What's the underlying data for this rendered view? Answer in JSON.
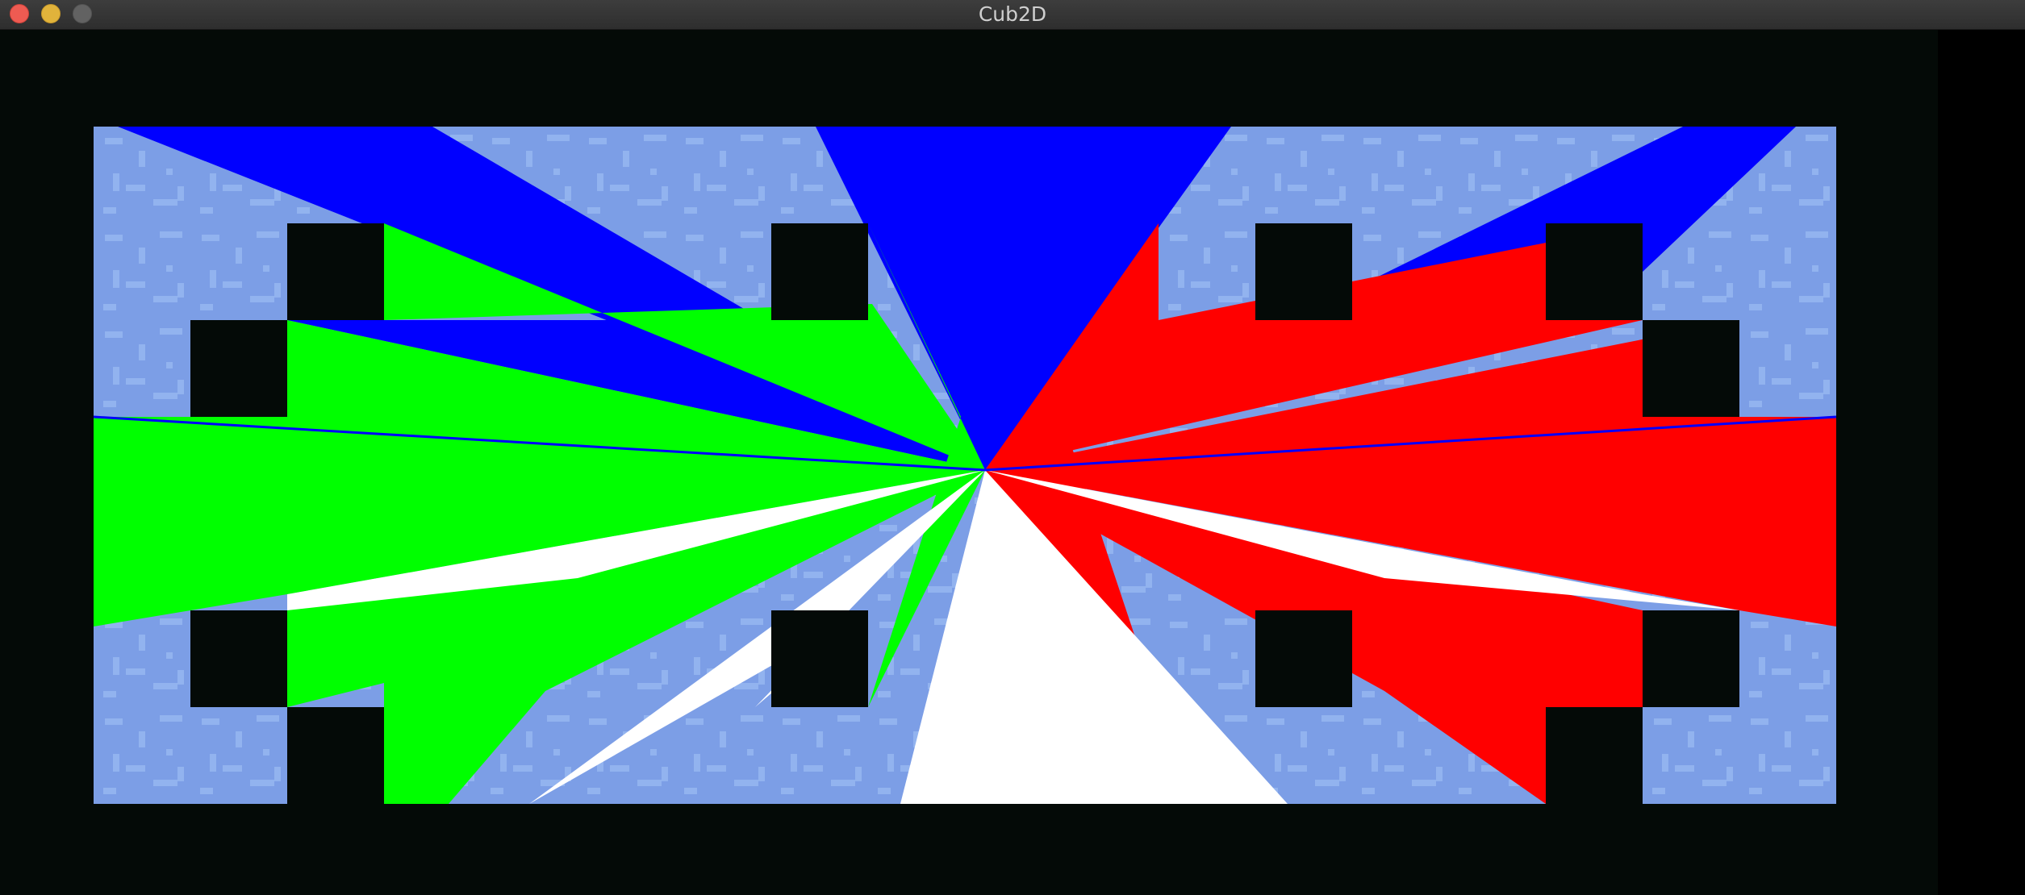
{
  "window": {
    "title": "Cub2D"
  },
  "colors": {
    "floor": "#7c9ee6",
    "floor_pattern": "#92b3ef",
    "wall": "#040a07",
    "ray_north": "#0000ff",
    "ray_west": "#00ff00",
    "ray_east": "#ff0000",
    "ray_south": "#ffffff"
  },
  "map": {
    "cols": 18,
    "rows": 7,
    "grid": [
      "000000000000000000",
      "001000010000100100",
      "010000000000000010",
      "000000000000000000",
      "000000000000000000",
      "010000010000100010",
      "001000000000000100"
    ]
  }
}
